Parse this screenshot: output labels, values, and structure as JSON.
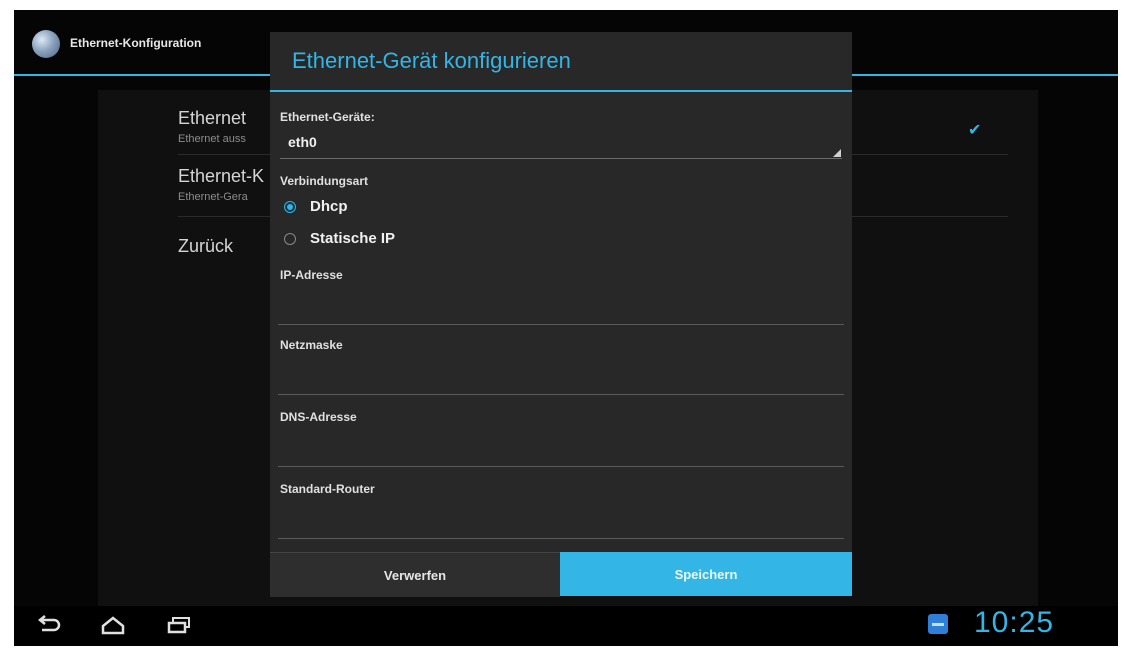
{
  "action_bar": {
    "title": "Ethernet-Konfiguration",
    "icon": "ethernet-settings-icon",
    "accent": "#33b5e5"
  },
  "background_list": {
    "items": [
      {
        "title": "Ethernet",
        "subtitle": "Ethernet auss"
      },
      {
        "title": "Ethernet-K",
        "subtitle": "Ethernet-Gera"
      },
      {
        "title": "Zurück",
        "subtitle": ""
      }
    ],
    "ethernet_checked": true
  },
  "dialog": {
    "title": "Ethernet-Gerät konfigurieren",
    "device_label": "Ethernet-Geräte:",
    "device_value": "eth0",
    "connection_type_label": "Verbindungsart",
    "connection_options": [
      {
        "label": "Dhcp",
        "selected": true
      },
      {
        "label": "Statische IP",
        "selected": false
      }
    ],
    "fields": [
      {
        "label": "IP-Adresse",
        "value": ""
      },
      {
        "label": "Netzmaske",
        "value": ""
      },
      {
        "label": "DNS-Adresse",
        "value": ""
      },
      {
        "label": "Standard-Router",
        "value": ""
      }
    ],
    "buttons": {
      "discard": "Verwerfen",
      "save": "Speichern"
    }
  },
  "system_bar": {
    "clock": "10:25",
    "nav_icons": [
      "back-icon",
      "home-icon",
      "recent-apps-icon"
    ],
    "notification_icon": "notification-icon"
  }
}
